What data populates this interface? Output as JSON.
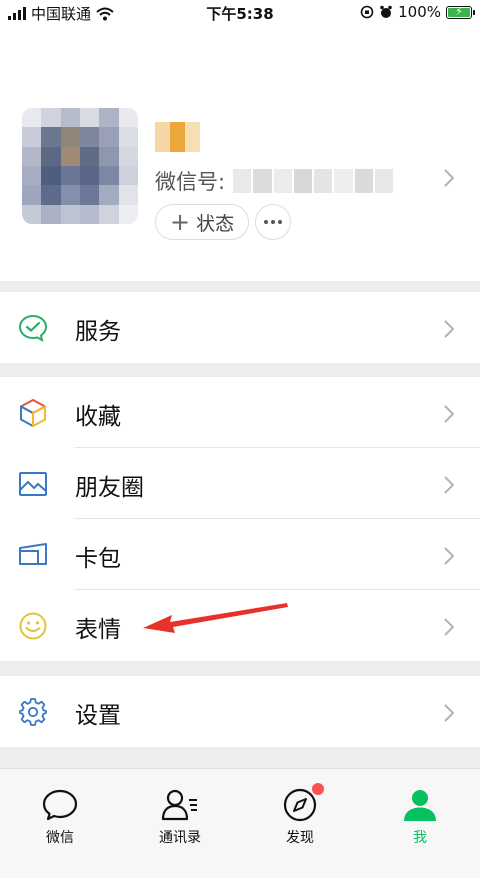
{
  "status_bar": {
    "carrier": "中国联通",
    "time": "下午5:38",
    "battery": "100%",
    "battery_level": 1.0
  },
  "profile": {
    "wechat_id_label": "微信号:",
    "status_button": "状态",
    "status_plus": "+"
  },
  "menu": {
    "services": "服务",
    "favorites": "收藏",
    "moments": "朋友圈",
    "cards": "卡包",
    "stickers": "表情",
    "settings": "设置"
  },
  "tabs": {
    "chats": "微信",
    "contacts": "通讯录",
    "discover": "发现",
    "me": "我"
  },
  "colors": {
    "accent": "#07c160",
    "badge": "#fa5151",
    "arrow": "#e8312a",
    "services_icon": "#2aae67",
    "moments_icon": "#3a78c2",
    "cards_icon": "#3a78c2",
    "stickers_icon": "#e0c438",
    "settings_icon": "#3a78c2"
  },
  "icons": {
    "services": "chat-check-icon",
    "favorites": "cube-icon",
    "moments": "landscape-image-icon",
    "cards": "card-wallet-icon",
    "stickers": "smiley-icon",
    "settings": "gear-icon",
    "chats_tab": "speech-bubble-icon",
    "contacts_tab": "contacts-person-icon",
    "discover_tab": "compass-icon",
    "me_tab": "person-icon"
  }
}
